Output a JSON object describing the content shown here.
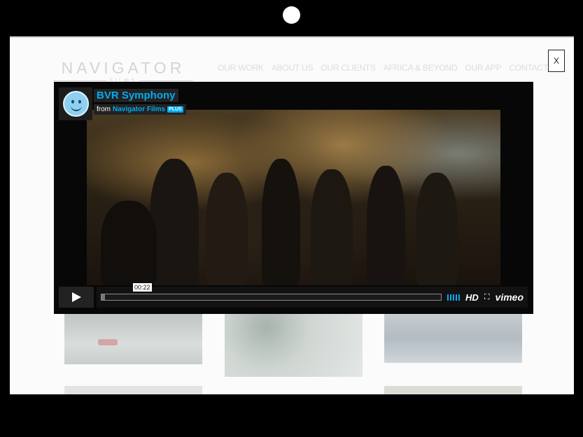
{
  "logo": {
    "main": "NAVIGATOR",
    "sub": "FILMS"
  },
  "nav": [
    "OUR WORK",
    "ABOUT US",
    "OUR CLIENTS",
    "AFRICA & BEYOND",
    "OUR APP",
    "CONTACT US"
  ],
  "close_label": "X",
  "video": {
    "title": "BVR Symphony",
    "by_prefix": "from",
    "by_user": "Navigator Films",
    "badge": "PLUS",
    "time": "00:22",
    "progress_fraction": 0.01,
    "hd_label": "HD",
    "brand": "vimeo"
  },
  "colors": {
    "accent": "#00adef"
  }
}
